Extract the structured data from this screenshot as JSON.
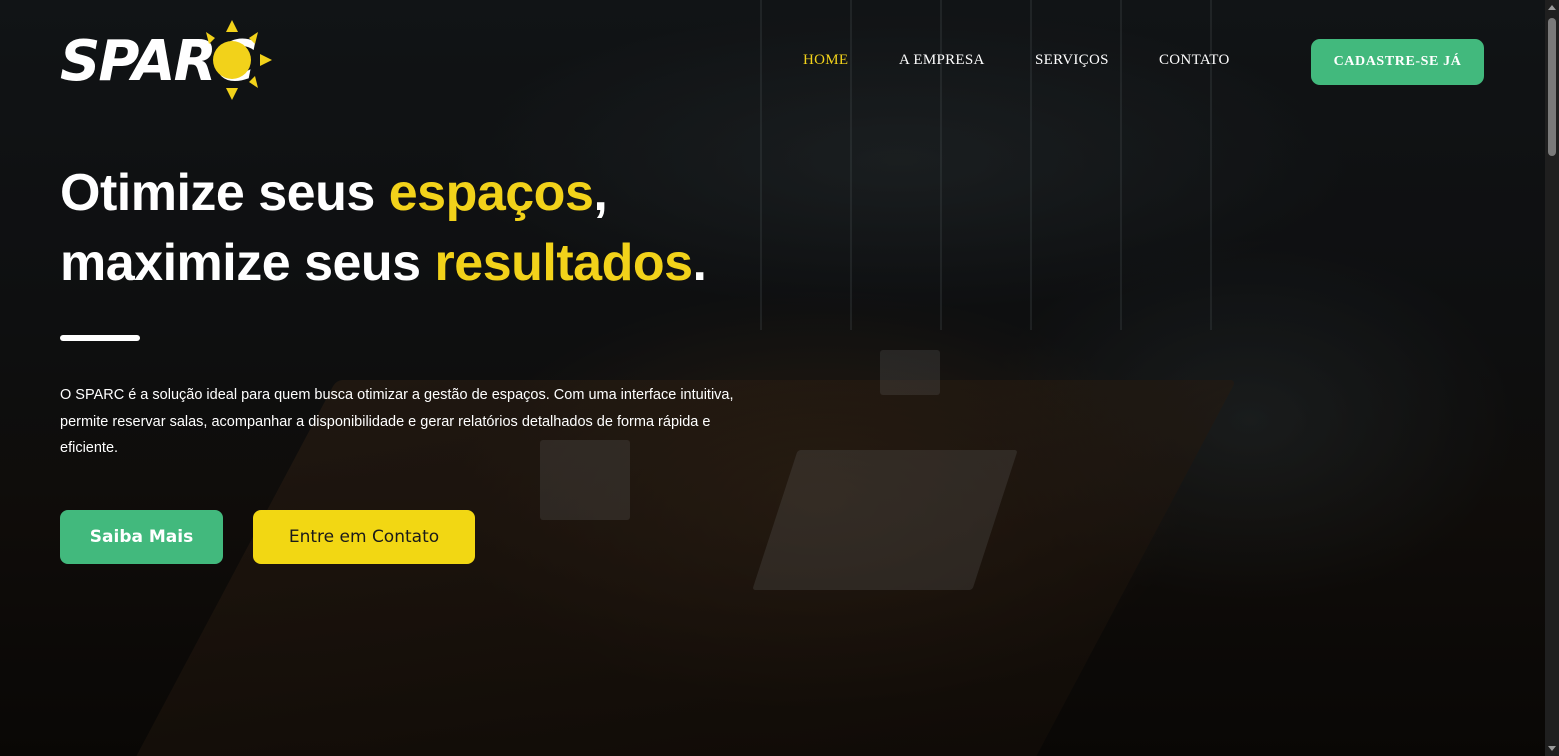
{
  "brand": {
    "logo_text": "SPARC",
    "accent_yellow": "#f2d21a",
    "accent_green": "#42b97d"
  },
  "nav": {
    "items": [
      {
        "label": "HOME",
        "active": true
      },
      {
        "label": "A EMPRESA",
        "active": false
      },
      {
        "label": "SERVIÇOS",
        "active": false
      },
      {
        "label": "CONTATO",
        "active": false
      }
    ],
    "cta_label": "CADASTRE-SE JÁ"
  },
  "hero": {
    "headline": {
      "line1_a": "Otimize seus ",
      "line1_highlight": "espaços",
      "line1_b": ",",
      "line2_a": "maximize seus ",
      "line2_highlight": "resultados",
      "line2_b": "."
    },
    "description": "O SPARC é a solução ideal para quem busca otimizar a gestão de espaços. Com uma interface intuitiva, permite reservar salas, acompanhar a disponibilidade e gerar relatórios detalhados de forma rápida e eficiente.",
    "primary_button": "Saiba Mais",
    "secondary_button": "Entre em Contato"
  }
}
